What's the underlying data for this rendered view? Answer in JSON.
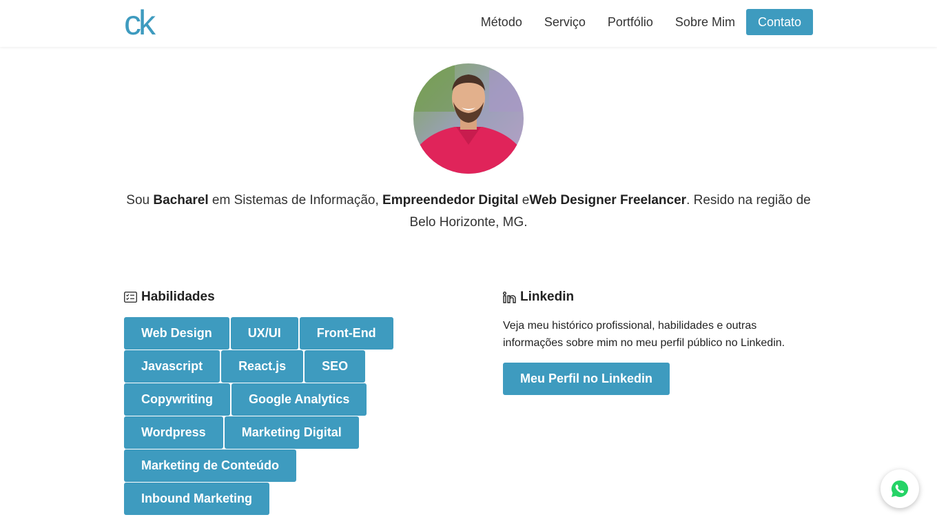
{
  "brand": {
    "logo_text": "ck",
    "accent": "#3e9bbf"
  },
  "nav": {
    "items": [
      "Método",
      "Serviço",
      "Portfólio",
      "Sobre Mim"
    ],
    "contact_label": "Contato"
  },
  "bio": {
    "part1": "Sou ",
    "bold1": "Bacharel",
    "part2": " em Sistemas de Informação, ",
    "bold2": "Empreendedor Digital",
    "part3": " e",
    "bold3": "Web Designer Freelancer",
    "part4": ". Resido na região de Belo Horizonte, MG."
  },
  "skills": {
    "title": "Habilidades",
    "icon": "checklist-icon",
    "rows": [
      [
        "Web Design",
        "UX/UI",
        "Front-End"
      ],
      [
        "Javascript",
        "React.js",
        "SEO"
      ],
      [
        "Copywriting",
        "Google Analytics"
      ],
      [
        "Wordpress",
        "Marketing Digital"
      ],
      [
        "Marketing de Conteúdo"
      ],
      [
        "Inbound Marketing"
      ]
    ]
  },
  "linkedin": {
    "title": "Linkedin",
    "icon": "linkedin-icon",
    "description": "Veja meu histórico profissional, habilidades e outras informações sobre mim no meu perfil público no Linkedin.",
    "button_label": "Meu Perfil no Linkedin"
  },
  "whatsapp": {
    "icon": "whatsapp-icon",
    "color": "#25d366"
  }
}
